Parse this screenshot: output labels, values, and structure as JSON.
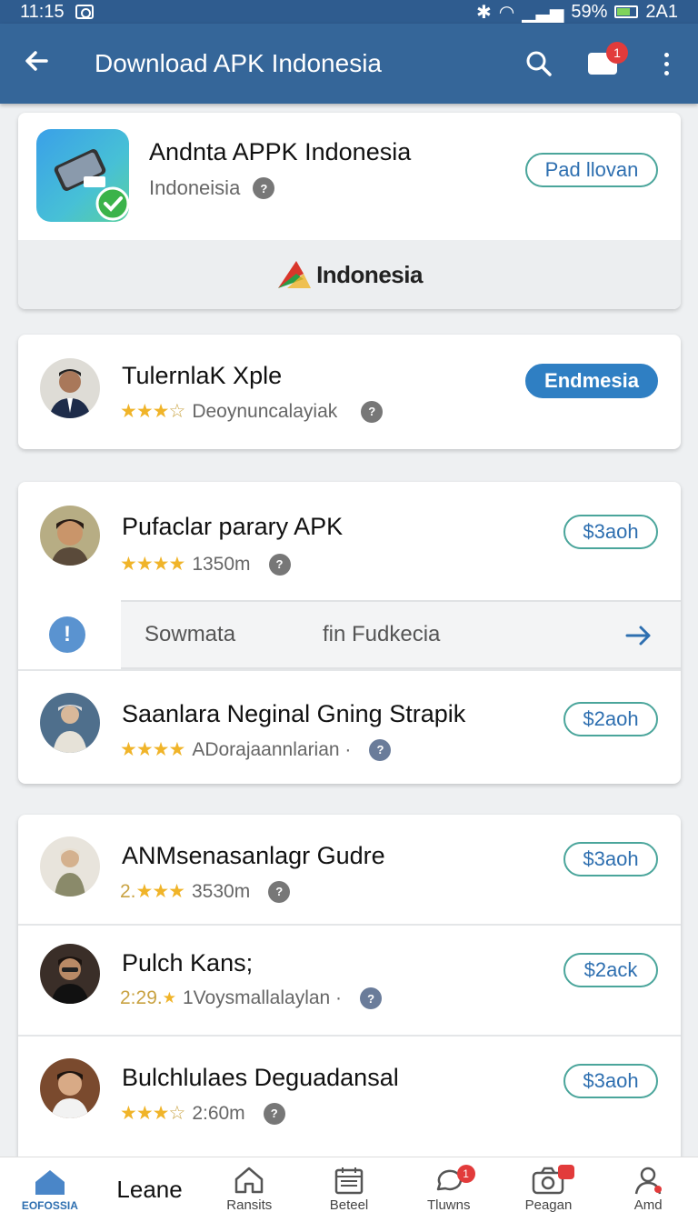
{
  "status_bar": {
    "time": "11:15",
    "battery": "59%",
    "network": "2A1"
  },
  "app_bar": {
    "title": "Download APK Indonesia",
    "notification_count": "1"
  },
  "featured": {
    "app_name": "Andnta APPK Indonesia",
    "subtitle": "Indoneisia",
    "button_label": "Pad llovan",
    "banner_text": "Indonesia"
  },
  "single_item": {
    "name": "TulernlaK Xple",
    "meta": "Deoynuncalayiak",
    "button_label": "Endmesia",
    "stars": 3
  },
  "group1": {
    "items": [
      {
        "name": "Pufaclar parary APK",
        "meta": "1350m",
        "button_label": "3aoh",
        "stars": 4
      },
      {
        "name": "Saanlara Neginal Gning Strapik",
        "meta": "ADorajaannlarian ·",
        "button_label": "2aoh",
        "stars": 4
      }
    ],
    "inline_bar": {
      "left_text": "Sowmata",
      "right_text": "fin Fudkecia"
    }
  },
  "group2": {
    "items": [
      {
        "name": "ANMsenasanlagr Gudre",
        "rating_prefix": "2.",
        "meta": "3530m",
        "button_label": "3aoh",
        "stars": 3
      },
      {
        "name": "Pulch Kans;",
        "rating_prefix": "2:29.",
        "meta": "1Voysmallalaylan ·",
        "button_label": "2ack",
        "stars": 1
      },
      {
        "name": "Bulchlulaes Deguadansal",
        "meta": "2:60m",
        "button_label": "3aoh",
        "stars": 3
      }
    ]
  },
  "floating_label": "Leane",
  "bottom_nav": {
    "items": [
      {
        "label": "EOFOSSIA",
        "icon": "home-icon"
      },
      {
        "label": "Ransits",
        "icon": "house-outline-icon"
      },
      {
        "label": "Beteel",
        "icon": "calendar-icon"
      },
      {
        "label": "Tluwns",
        "icon": "chat-icon",
        "badge": "1"
      },
      {
        "label": "Peagan",
        "icon": "camera-icon",
        "badge": ""
      },
      {
        "label": "Amd",
        "icon": "profile-icon"
      }
    ]
  },
  "colors": {
    "app_bar": "#356699",
    "status_bar": "#2f5c8f",
    "accent_blue": "#2e6fb0",
    "pill_border": "#4aa59b",
    "star": "#f0b429",
    "badge": "#e23b3b"
  }
}
